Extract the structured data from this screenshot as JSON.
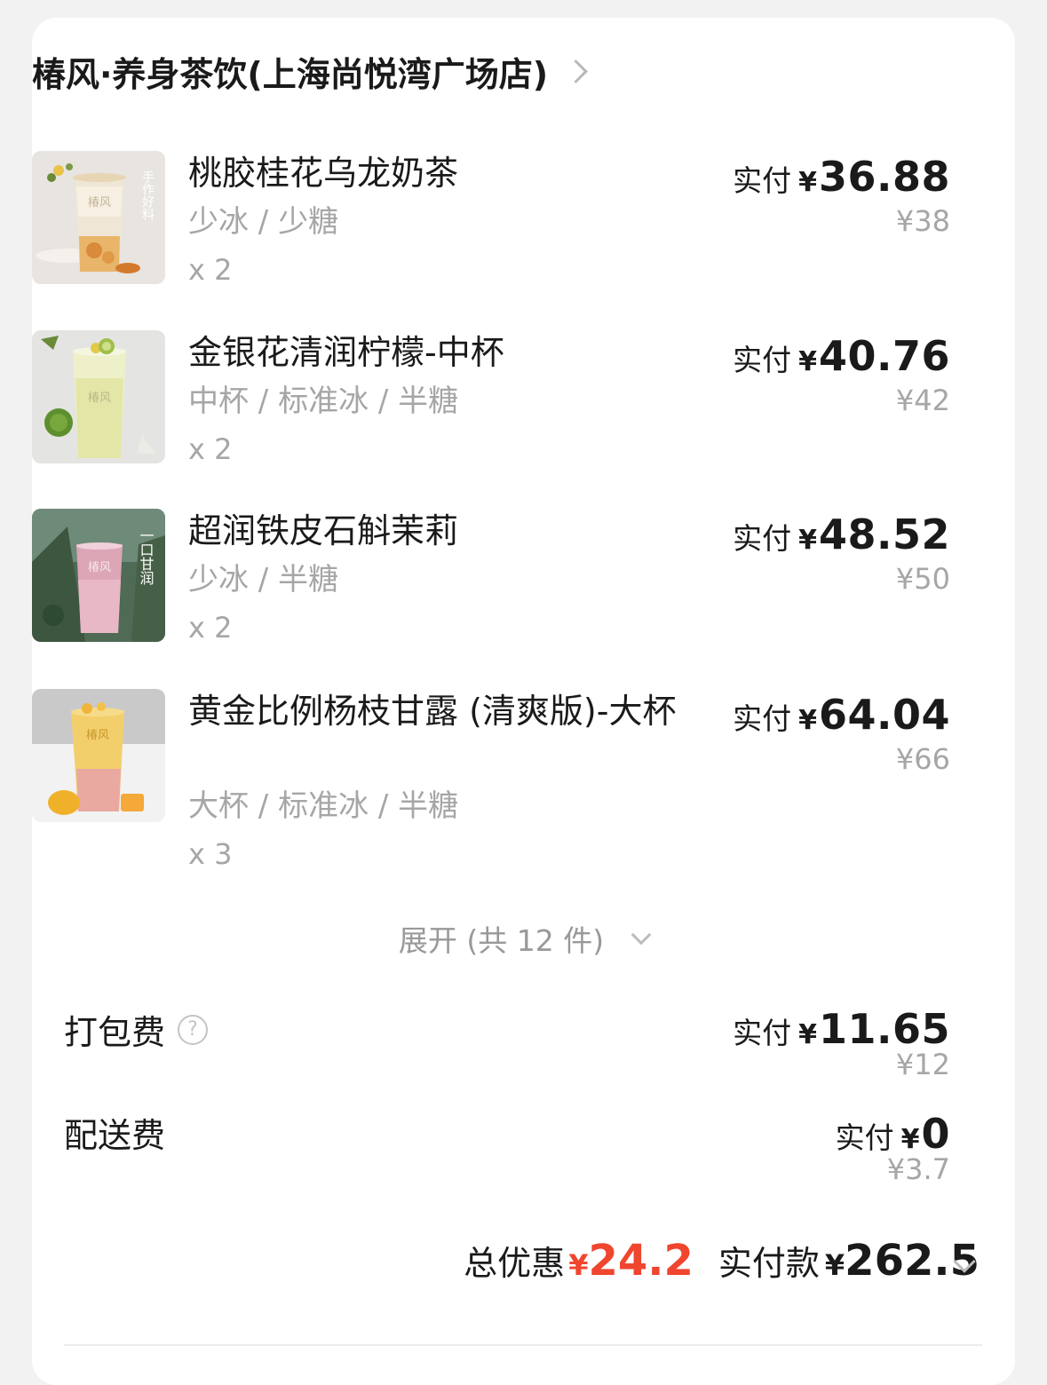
{
  "store": {
    "name": "椿风·养身茶饮(上海尚悦湾广场店)"
  },
  "items": [
    {
      "name": "桃胶桂花乌龙奶茶",
      "spec": "少冰 / 少糖",
      "qty": "x 2",
      "paid_label": "实付",
      "currency": "¥",
      "paid": "36.88",
      "original": "¥38",
      "thumb_text": "手作好料",
      "cup_logo": "椿风"
    },
    {
      "name": "金银花清润柠檬-中杯",
      "spec": "中杯 / 标准冰 / 半糖",
      "qty": "x 2",
      "paid_label": "实付",
      "currency": "¥",
      "paid": "40.76",
      "original": "¥42",
      "cup_logo": "椿风"
    },
    {
      "name": "超润铁皮石斛茉莉",
      "spec": "少冰 / 半糖",
      "qty": "x 2",
      "paid_label": "实付",
      "currency": "¥",
      "paid": "48.52",
      "original": "¥50",
      "thumb_text": "一口甘润",
      "cup_logo": "椿风"
    },
    {
      "name": "黄金比例杨枝甘露 (清爽版)-大杯",
      "spec": "大杯 / 标准冰 / 半糖",
      "qty": "x 3",
      "paid_label": "实付",
      "currency": "¥",
      "paid": "64.04",
      "original": "¥66",
      "cup_logo": "椿风"
    }
  ],
  "expand": {
    "label": "展开 (共 12 件)"
  },
  "fees": [
    {
      "label": "打包费",
      "help": "?",
      "paid_label": "实付",
      "currency": "¥",
      "paid": "11.65",
      "original": "¥12"
    },
    {
      "label": "配送费",
      "paid_label": "实付",
      "currency": "¥",
      "paid": "0",
      "original": "¥3.7"
    }
  ],
  "summary": {
    "discount_label": "总优惠",
    "discount_currency": "¥",
    "discount": "24.2",
    "total_label": "实付款",
    "total_currency": "¥",
    "total": "262.5"
  },
  "colors": {
    "accent_red": "#f0452e",
    "muted": "#a6a6a6"
  },
  "icons": [
    "chevron-right-icon",
    "chevron-down-icon",
    "help-icon"
  ]
}
